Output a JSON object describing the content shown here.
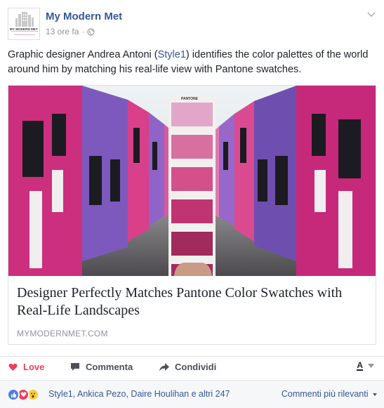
{
  "page": {
    "name": "My Modern Met",
    "logo_text": "MY MODERN MET",
    "timestamp": "13 ore fa",
    "separator": "·"
  },
  "post": {
    "text_before": "Graphic designer Andrea Antoni (",
    "tag": "Style1",
    "text_after": ") identifies the color palettes of the world around him by matching his real-life view with Pantone swatches."
  },
  "link": {
    "title": "Designer Perfectly Matches Pantone Color Swatches with Real-Life Landscapes",
    "domain": "MYMODERNMET.COM",
    "pantone_label": "PANTONE",
    "colors": {
      "magenta": "#cc2f7e",
      "purple": "#7755b8",
      "pink": "#e0468f",
      "sky": "#dde3e6",
      "street": "#6e6e72"
    }
  },
  "actions": {
    "love": "Love",
    "comment": "Commenta",
    "share": "Condividi",
    "audience_icon": "A"
  },
  "reactions": {
    "icons": [
      "like-icon",
      "love-icon",
      "wow-icon"
    ],
    "summary": "Style1, Ankica Pezo, Daire Houlihan e altri 247",
    "sort": "Commenti più rilevanti"
  },
  "colors": {
    "link_blue": "#365899",
    "love_red": "#f33e58",
    "meta_gray": "#90949c"
  }
}
